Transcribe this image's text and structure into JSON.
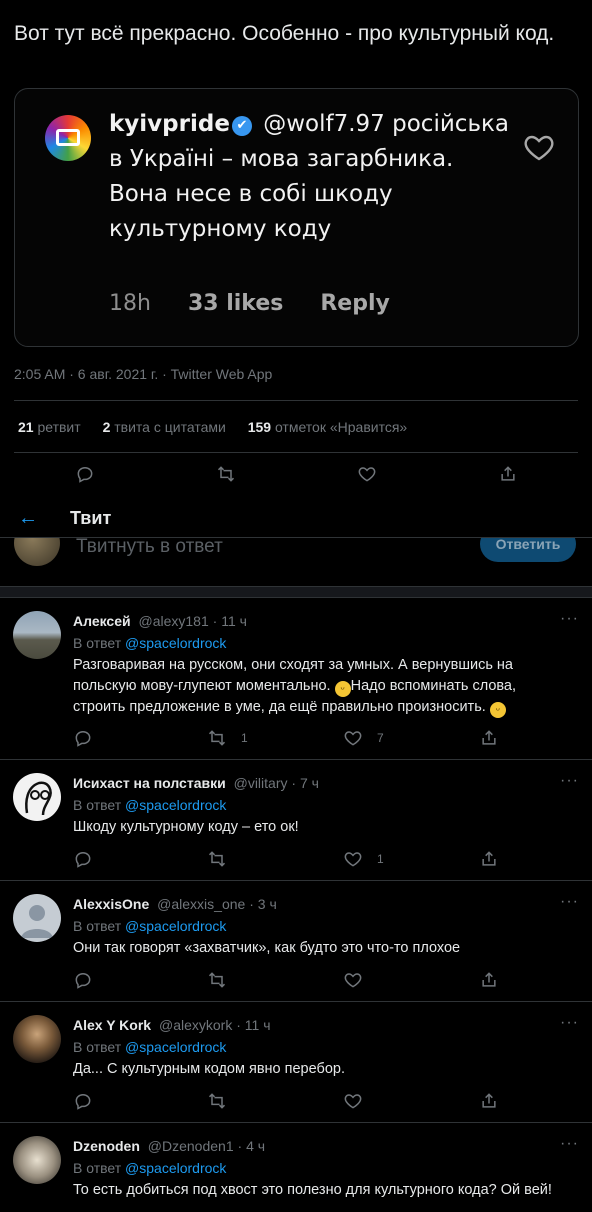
{
  "tweet": {
    "text": "Вот тут всё прекрасно. Особенно - про культурный код.",
    "timestamp": "2:05 AM · 6 авг. 2021 г. · Twitter Web App",
    "stats": {
      "retweets_count": "21",
      "retweets_label": "ретвит",
      "quotes_count": "2",
      "quotes_label": "твита с цитатами",
      "likes_count": "159",
      "likes_label": "отметок «Нравится»"
    }
  },
  "embed": {
    "username": "kyivpride",
    "verified_mark": "✔",
    "mention": "@wolf7.97",
    "comment": "російська в Україні – мова загарбника. Вона несе в собі шкоду культурному коду",
    "time": "18h",
    "likes": "33 likes",
    "reply": "Reply"
  },
  "header": {
    "back_glyph": "←",
    "title": "Твит"
  },
  "composer": {
    "placeholder": "Твитнуть в ответ",
    "button": "Ответить"
  },
  "replies": [
    {
      "name": "Алексей",
      "handle": "@alexy181",
      "time": "11 ч",
      "in_reply_label": "В ответ",
      "in_reply_to": "@spacelordrock",
      "text_1": "Разговаривая на русском, они сходят за умных. А вернувшись на польскую мову-глупеют моментально. ",
      "text_2": "Надо вспоминать слова, строить предложение в уме, да ещё правильно произносить. ",
      "emoji": "😁",
      "retweets": "1",
      "likes": "7"
    },
    {
      "name": "Исихаст на полставки",
      "handle": "@vilitary",
      "time": "7 ч",
      "in_reply_label": "В ответ",
      "in_reply_to": "@spacelordrock",
      "text": "Шкоду культурному коду – ето ок!",
      "retweets": "",
      "likes": "1"
    },
    {
      "name": "AlexxisOne",
      "handle": "@alexxis_one",
      "time": "3 ч",
      "in_reply_label": "В ответ",
      "in_reply_to": "@spacelordrock",
      "text": "Они так говорят «захватчик», как будто это что-то плохое",
      "retweets": "",
      "likes": ""
    },
    {
      "name": "Alex Y Kork",
      "handle": "@alexykork",
      "time": "11 ч",
      "in_reply_label": "В ответ",
      "in_reply_to": "@spacelordrock",
      "text": "Да... С культурным кодом явно перебор.",
      "retweets": "",
      "likes": ""
    },
    {
      "name": "Dzenoden",
      "handle": "@Dzenoden1",
      "time": "4 ч",
      "in_reply_label": "В ответ",
      "in_reply_to": "@spacelordrock",
      "text": "То есть добиться под хвост это полезно для культурного кода? Ой вей!",
      "retweets": "",
      "likes": ""
    }
  ],
  "more_glyph": "···",
  "colors": {
    "accent": "#1d9bf0",
    "background": "#000000",
    "muted": "#71767b",
    "border": "#2f3336"
  }
}
